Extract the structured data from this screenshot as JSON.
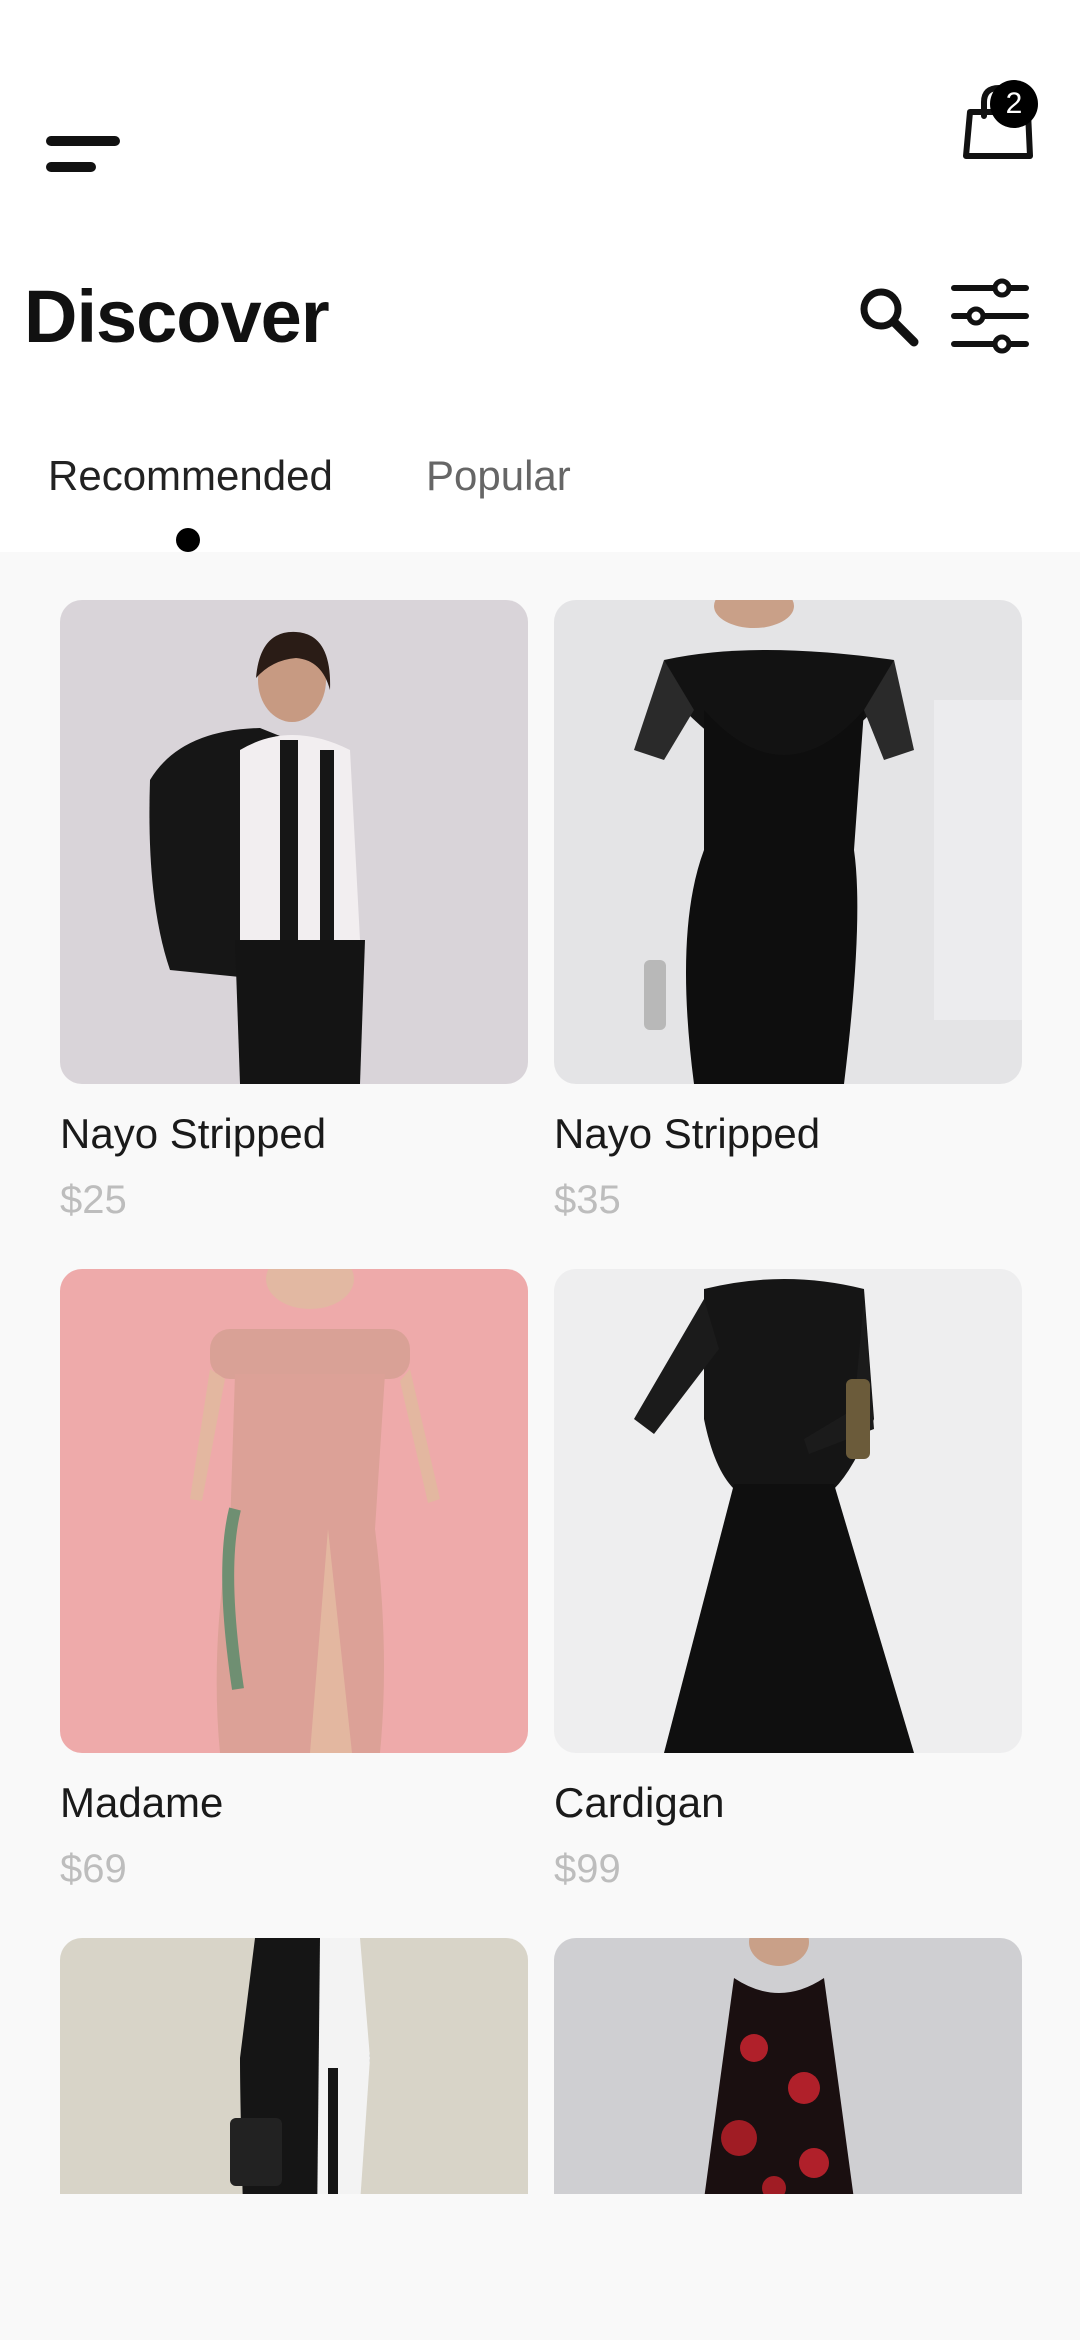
{
  "header": {
    "title": "Discover",
    "cart_count": "2",
    "icons": [
      "menu-icon",
      "shopping-bag-icon",
      "search-icon",
      "filter-sliders-icon"
    ]
  },
  "tabs": [
    {
      "label": "Recommended",
      "active": true
    },
    {
      "label": "Popular",
      "active": false
    }
  ],
  "products": [
    {
      "name": "Nayo Stripped",
      "price": "$25",
      "image_bg": "#d9d4d9"
    },
    {
      "name": "Nayo Stripped",
      "price": "$35",
      "image_bg": "#e4e4e6"
    },
    {
      "name": "Madame",
      "price": "$69",
      "image_bg": "#eeaaaa"
    },
    {
      "name": "Cardigan",
      "price": "$99",
      "image_bg": "#eeeeef"
    },
    {
      "name": "",
      "price": "",
      "image_bg": "#d8d4c8"
    },
    {
      "name": "",
      "price": "",
      "image_bg": "#cfcfd2"
    }
  ],
  "colors": {
    "accent": "#000000",
    "price": "#bdbdbd",
    "background": "#f9f9f9"
  }
}
